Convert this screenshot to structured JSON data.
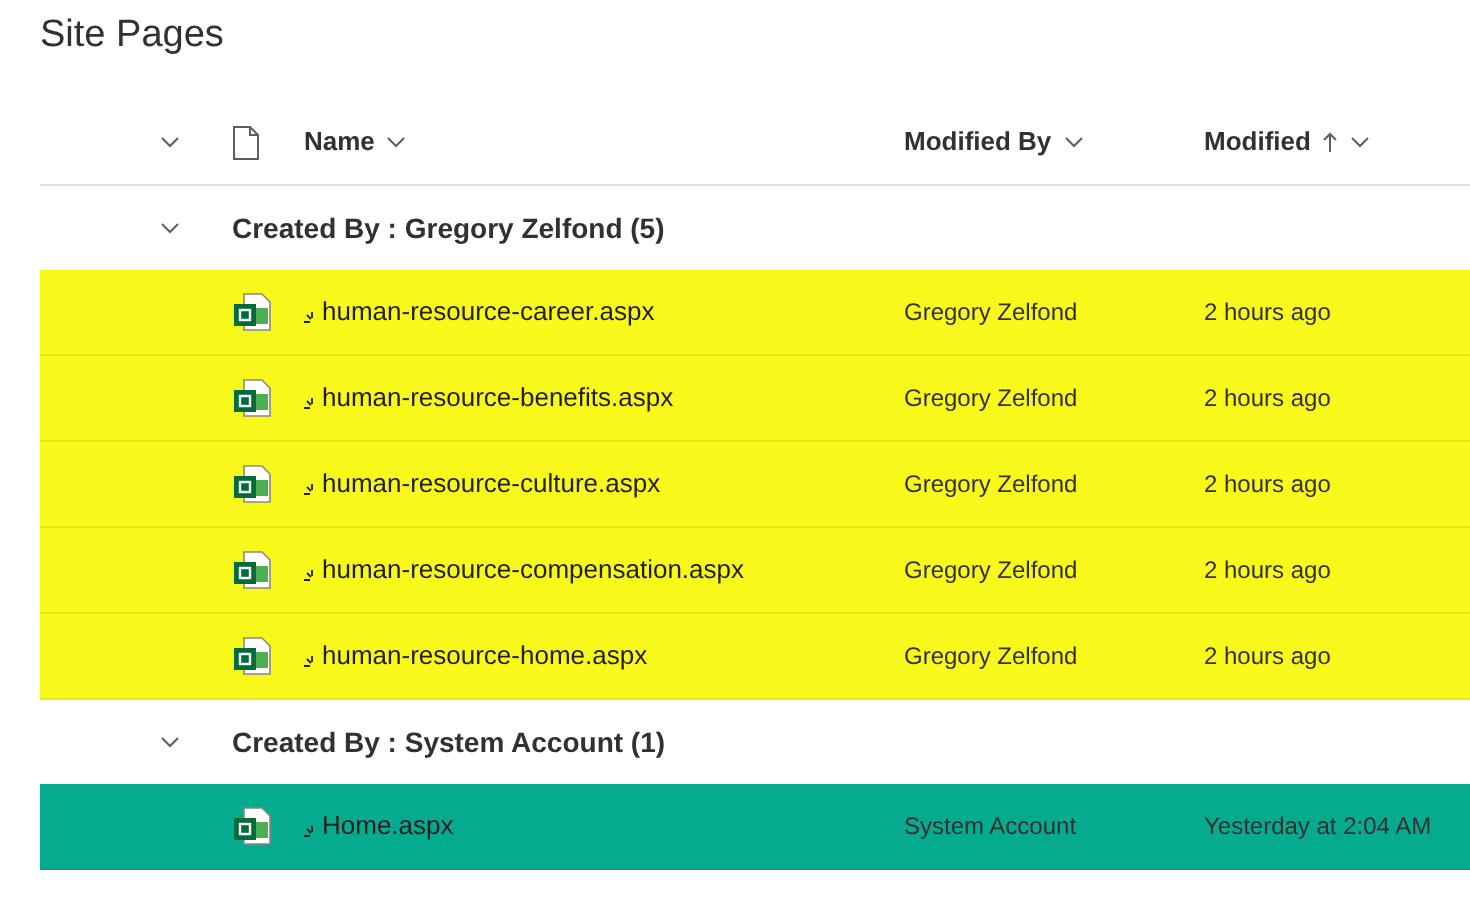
{
  "title": "Site Pages",
  "columns": [
    {
      "label": "Name",
      "sorted": false
    },
    {
      "label": "Modified By",
      "sorted": false
    },
    {
      "label": "Modified",
      "sorted": true
    }
  ],
  "groups": [
    {
      "label": "Created By : Gregory Zelfond (5)",
      "expanded": true,
      "rows": [
        {
          "name": "human-resource-career.aspx",
          "modified_by": "Gregory Zelfond",
          "modified": "2 hours ago",
          "color": "#f8f81a"
        },
        {
          "name": "human-resource-benefits.aspx",
          "modified_by": "Gregory Zelfond",
          "modified": "2 hours ago",
          "color": "#f8f81a"
        },
        {
          "name": "human-resource-culture.aspx",
          "modified_by": "Gregory Zelfond",
          "modified": "2 hours ago",
          "color": "#f8f81a"
        },
        {
          "name": "human-resource-compensation.aspx",
          "modified_by": "Gregory Zelfond",
          "modified": "2 hours ago",
          "color": "#f8f81a"
        },
        {
          "name": "human-resource-home.aspx",
          "modified_by": "Gregory Zelfond",
          "modified": "2 hours ago",
          "color": "#f8f81a"
        }
      ]
    },
    {
      "label": "Created By : System Account (1)",
      "expanded": true,
      "rows": [
        {
          "name": "Home.aspx",
          "modified_by": "System Account",
          "modified": "Yesterday at 2:04 AM",
          "color": "#05ab8f"
        }
      ]
    }
  ]
}
